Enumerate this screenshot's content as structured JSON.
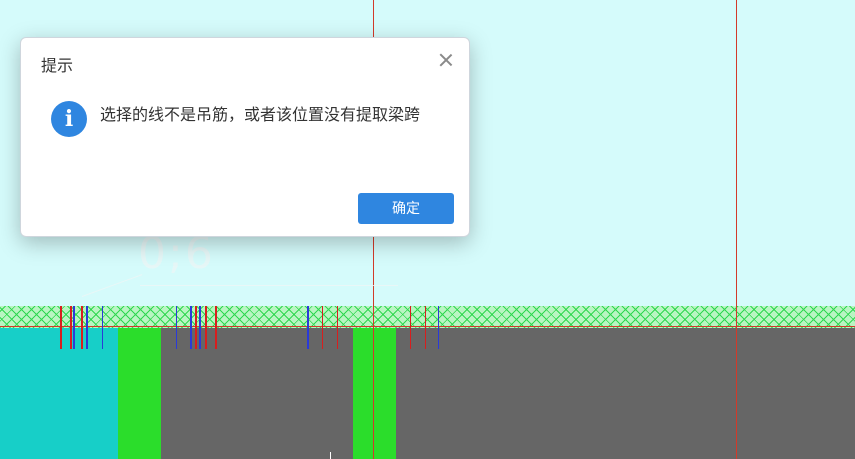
{
  "drawing": {
    "dimension_text": "0;6",
    "colors": {
      "background": "#d5fbfb",
      "hatch": "#2fd850",
      "teal_block": "#17cfc8",
      "green_block": "#2bdd2b",
      "gray_block": "#666666",
      "red_line": "#d23a2a"
    }
  },
  "dialog": {
    "title": "提示",
    "close_icon": "close-icon",
    "info_icon": "info-icon",
    "info_glyph": "i",
    "message": "选择的线不是吊筋，或者该位置没有提取梁跨",
    "ok_label": "确定",
    "accent_color": "#2f86e0"
  }
}
